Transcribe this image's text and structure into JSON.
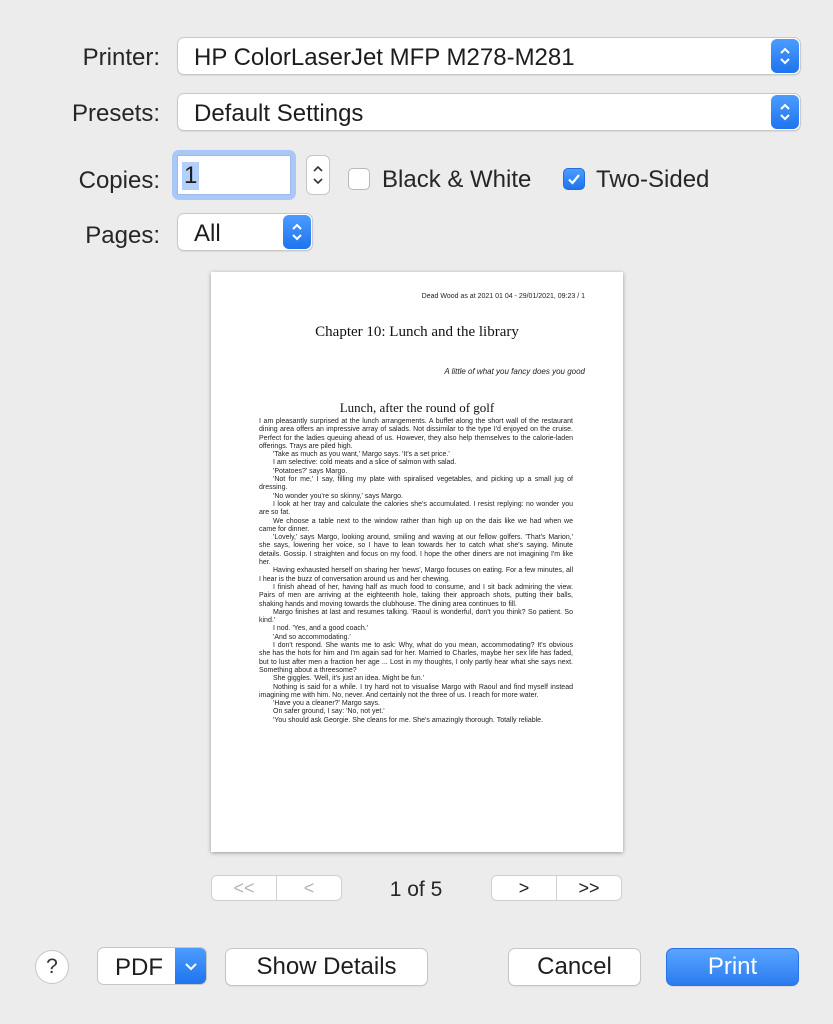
{
  "printer": {
    "label": "Printer:",
    "value": "HP ColorLaserJet MFP M278-M281"
  },
  "presets": {
    "label": "Presets:",
    "value": "Default Settings"
  },
  "copies": {
    "label": "Copies:",
    "value": "1"
  },
  "black_white": {
    "label": "Black & White",
    "checked": false
  },
  "two_sided": {
    "label": "Two-Sided",
    "checked": true
  },
  "pages": {
    "label": "Pages:",
    "value": "All"
  },
  "preview": {
    "header": "Dead Wood as at 2021 01 04 - 29/01/2021, 09:23 / 1",
    "chapter_title": "Chapter 10: Lunch and the library",
    "epigraph": "A little of what you fancy does you good",
    "section_title": "Lunch, after the round of golf",
    "paragraphs": [
      "I am pleasantly surprised at the lunch arrangements. A buffet along the short wall of the restaurant dining area offers an impressive array of salads. Not dissimilar to the type I'd enjoyed on the cruise. Perfect for the ladies queuing ahead of us. However, they also help themselves to the calorie-laden offerings. Trays are piled high.",
      "'Take as much as you want,' Margo says. 'It's a set price.'",
      "I am selective: cold meats and a slice of salmon with salad.",
      "'Potatoes?' says Margo.",
      "'Not for me,' I say, filling my plate with spiralised vegetables, and picking up a small jug of dressing.",
      "'No wonder you're so skinny,' says Margo.",
      "I look at her tray and calculate the calories she's accumulated. I resist replying: no wonder you are so fat.",
      "We choose a table next to the window rather than high up on the dais like we had when we came for dinner.",
      "'Lovely,' says Margo, looking around, smiling and waving at our fellow golfers. 'That's Marion,' she says, lowering her voice, so I have to lean towards her to catch what she's saying. Minute details. Gossip. I straighten and focus on my food. I hope the other diners are not imagining I'm like her.",
      "Having exhausted herself on sharing her 'news', Margo focuses on eating. For a few minutes, all I hear is the buzz of conversation around us and her chewing.",
      "I finish ahead of her, having half as much food to consume, and I sit back admiring the view. Pairs of men are arriving at the eighteenth hole, taking their approach shots, putting their balls, shaking hands and moving towards the clubhouse. The dining area continues to fill.",
      "Margo finishes at last and resumes talking. 'Raoul is wonderful, don't you think? So patient. So kind.'",
      "I nod. 'Yes, and a good coach.'",
      "'And so accommodating.'",
      "I don't respond. She wants me to ask: Why, what do you mean, accommodating? It's obvious she has the hots for him and I'm again sad for her. Married to Charles, maybe her sex life has faded, but to lust after men a fraction her age ... Lost in my thoughts, I only partly hear what she says next. Something about a threesome?",
      "She giggles. 'Well, it's just an idea. Might be fun.'",
      "Nothing is said for a while. I try hard not to visualise Margo with Raoul and find myself instead imagining me with him. No, never. And certainly not the three of us. I reach for more water.",
      "'Have you a cleaner?' Margo says.",
      "On safer ground, I say: 'No, not yet.'",
      "'You should ask Georgie. She cleans for me. She's amazingly thorough. Totally reliable."
    ]
  },
  "navigation": {
    "first": "<<",
    "prev": "<",
    "next": ">",
    "last": ">>",
    "page_count": "1 of 5"
  },
  "footer": {
    "help": "?",
    "pdf": "PDF",
    "show_details": "Show Details",
    "cancel": "Cancel",
    "print": "Print"
  },
  "colors": {
    "accent": "#2a7bf0",
    "background": "#ececec"
  }
}
